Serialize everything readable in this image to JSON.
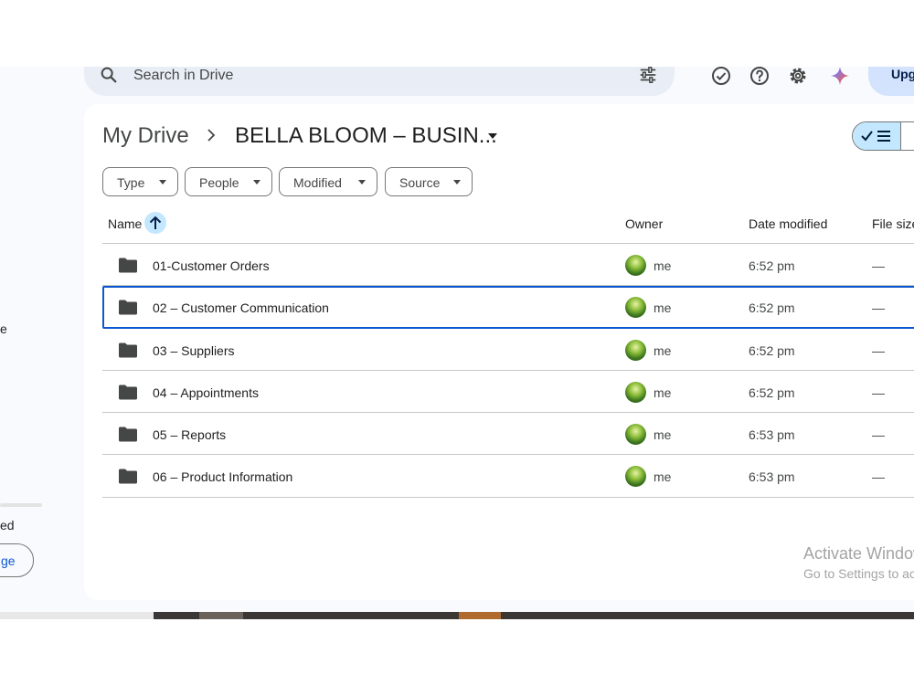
{
  "search": {
    "placeholder": "Search in Drive"
  },
  "header": {
    "upgrade_label": "Upg"
  },
  "sidebar": {
    "fragment_1": "e",
    "fragment_2": "ed",
    "get_storage_label": "ge"
  },
  "breadcrumb": {
    "root": "My Drive",
    "current": "BELLA BLOOM – BUSIN..."
  },
  "filters": [
    "Type",
    "People",
    "Modified",
    "Source"
  ],
  "table": {
    "columns": {
      "name": "Name",
      "owner": "Owner",
      "date_modified": "Date modified",
      "file_size": "File size"
    },
    "rows": [
      {
        "name": "01-Customer Orders",
        "owner": "me",
        "date": "6:52 pm",
        "size": "—"
      },
      {
        "name": "02 – Customer Communication",
        "owner": "me",
        "date": "6:52 pm",
        "size": "—"
      },
      {
        "name": "03 – Suppliers",
        "owner": "me",
        "date": "6:52 pm",
        "size": "—"
      },
      {
        "name": "04 – Appointments",
        "owner": "me",
        "date": "6:52 pm",
        "size": "—"
      },
      {
        "name": "05 – Reports",
        "owner": "me",
        "date": "6:53 pm",
        "size": "—"
      },
      {
        "name": "06 – Product Information",
        "owner": "me",
        "date": "6:53 pm",
        "size": "—"
      }
    ],
    "selected_row": 1
  },
  "watermark": {
    "title": "Activate Windows",
    "subtitle": "Go to Settings to activate Windows."
  },
  "colors": {
    "accent": "#0b57d0",
    "selected_chip": "#c2e7ff",
    "search_bg": "#e9eef6"
  }
}
